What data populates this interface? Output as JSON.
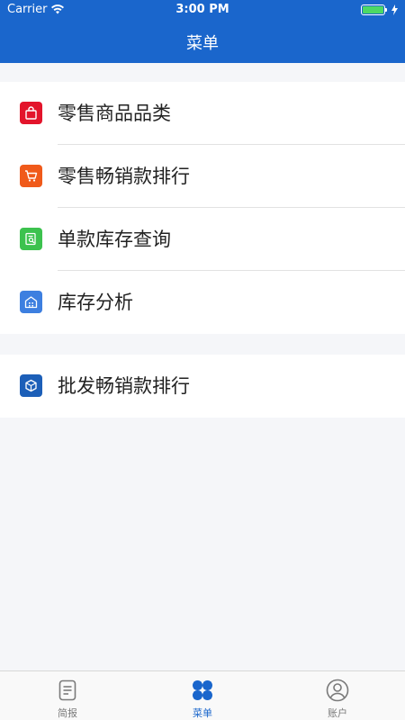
{
  "status_bar": {
    "carrier": "Carrier",
    "time": "3:00 PM",
    "battery_level": 1.0
  },
  "nav": {
    "title": "菜单"
  },
  "menu": {
    "groups": [
      {
        "items": [
          {
            "label": "零售商品品类",
            "icon": "shopping-bag-icon",
            "icon_color": "#e3142b"
          },
          {
            "label": "零售畅销款排行",
            "icon": "cart-icon",
            "icon_color": "#f05a1a"
          },
          {
            "label": "单款库存查询",
            "icon": "search-document-icon",
            "icon_color": "#3cc24e"
          },
          {
            "label": "库存分析",
            "icon": "warehouse-icon",
            "icon_color": "#3d7fe0"
          }
        ]
      },
      {
        "items": [
          {
            "label": "批发畅销款排行",
            "icon": "package-icon",
            "icon_color": "#1c5fb8"
          }
        ]
      }
    ]
  },
  "tabbar": {
    "tabs": [
      {
        "label": "简报",
        "icon": "document-icon",
        "active": false
      },
      {
        "label": "菜单",
        "icon": "grid-icon",
        "active": true
      },
      {
        "label": "账户",
        "icon": "user-icon",
        "active": false
      }
    ]
  },
  "colors": {
    "primary": "#1a66cc",
    "background": "#f5f6f9"
  }
}
